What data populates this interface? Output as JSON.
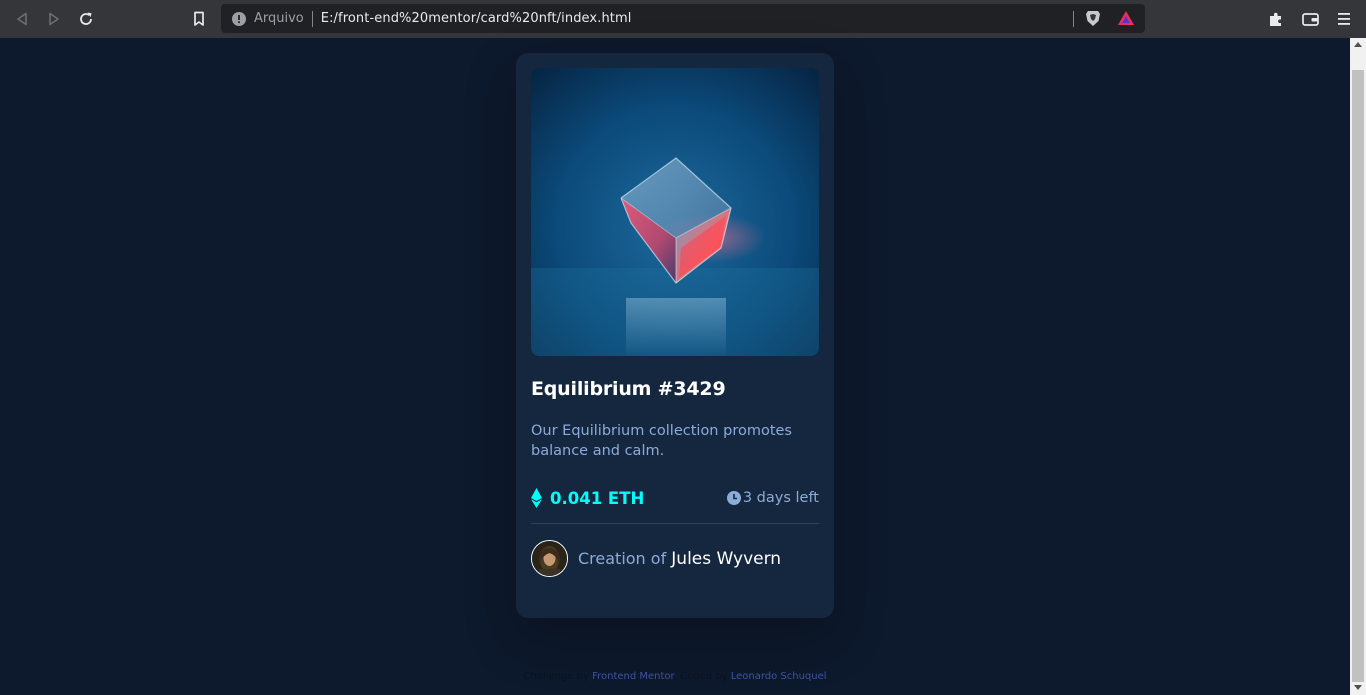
{
  "browser": {
    "url_prefix": "Arquivo",
    "url": "E:/front-end%20mentor/card%20nft/index.html",
    "icons": [
      "back-icon",
      "forward-icon",
      "reload-icon",
      "bookmark-icon",
      "info-icon",
      "brave-shield-icon",
      "brave-rewards-icon",
      "extensions-icon",
      "wallet-icon",
      "menu-icon"
    ]
  },
  "card": {
    "image_alt": "equilibrium",
    "title": "Equilibrium #3429",
    "description": "Our Equilibrium collection promotes balance and calm.",
    "price": "0.041 ETH",
    "time_left": "3 days left",
    "creator_prefix": "Creation of",
    "creator_name": "Jules Wyvern"
  },
  "footer": {
    "challenge_text": "Challenge by",
    "challenge_link": "Frontend Mentor",
    "coded_text": ". Coded by",
    "coded_link": "Leonardo Schuquel"
  },
  "colors": {
    "page_bg": "#0d192c",
    "card_bg": "#15263f",
    "accent_cyan": "#00fff8",
    "soft_blue": "#8bacd9",
    "white": "#ffffff"
  }
}
